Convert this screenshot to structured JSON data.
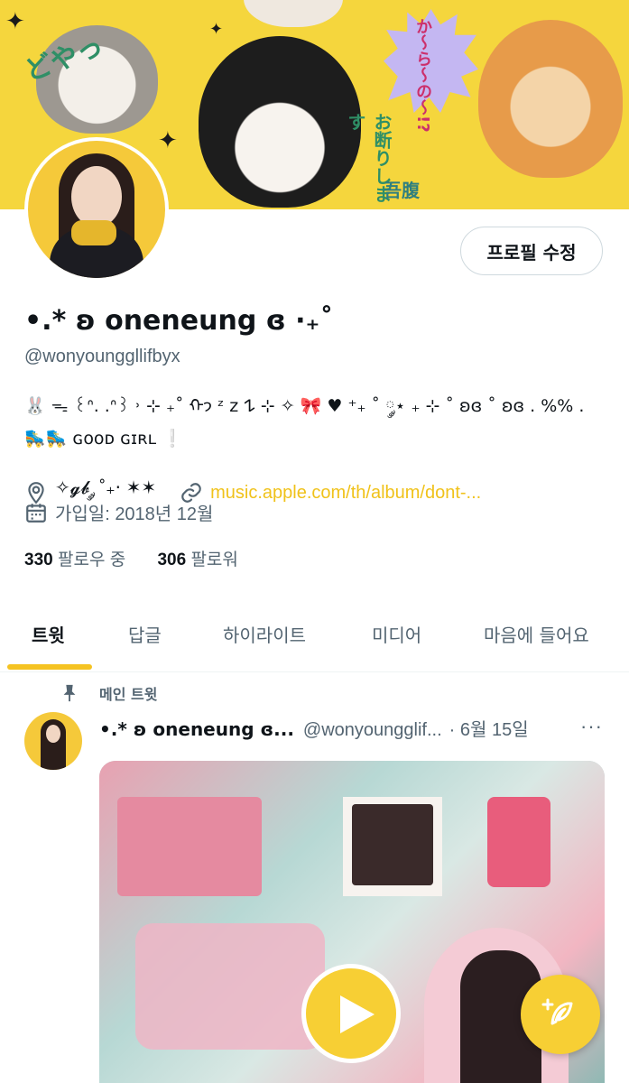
{
  "banner": {
    "text_1": "どやっ",
    "text_2": "お断りします",
    "text_3": "か〜ら〜の〜!?",
    "text_4": "吾腹"
  },
  "profile": {
    "edit_label": "프로필 수정",
    "name": "•.* ʚ oneneung ɞ ·₊˚",
    "handle": "@wonyounggllifbyx",
    "bio": "🐰 ᯓ ꒰ᐢ. .ᐢ꒱ ˒ ⊹ ₊˚ ᡣ𐭩 ᶻ 𝗓 𐰁 ⊹ ✧ 🎀 ♥ ⁺₊ ˚ ༘⋆ ₊ ⊹ ˚ ʚɞ ˚ ʚɞ . %% . 🛼🛼 ɢᴏᴏᴅ ɢɪʀʟ ❕",
    "location": "✧𝓰𝓫 ༘ ˚₊‧ ✶✶",
    "link": "music.apple.com/th/album/dont-...",
    "joined": "가입일: 2018년 12월",
    "following_count": "330",
    "following_label": "팔로우 중",
    "followers_count": "306",
    "followers_label": "팔로워"
  },
  "tabs": [
    {
      "label": "트윗"
    },
    {
      "label": "답글"
    },
    {
      "label": "하이라이트"
    },
    {
      "label": "미디어"
    },
    {
      "label": "마음에 들어요"
    }
  ],
  "tweet": {
    "pinned_label": "메인 트윗",
    "name": "•.* ʚ oneneung ɞ...",
    "handle": "@wonyoungglif...",
    "date": "· 6월 15일",
    "more": "···"
  },
  "colors": {
    "accent": "#f5c322",
    "text_primary": "#0f1419",
    "text_secondary": "#536471"
  },
  "icons": {
    "location": "location-pin-icon",
    "link": "link-icon",
    "calendar": "calendar-icon",
    "pin": "pin-icon",
    "play": "play-icon",
    "compose": "compose-feather-icon"
  }
}
